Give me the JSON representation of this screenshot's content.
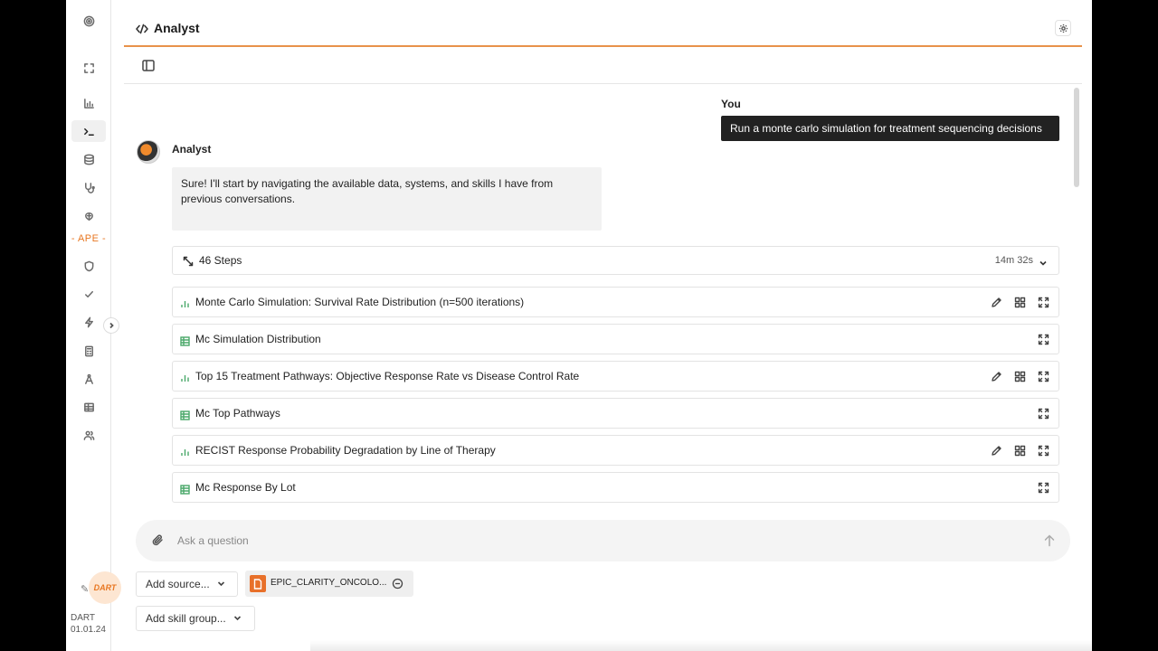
{
  "header": {
    "title": "Analyst"
  },
  "sidebar": {
    "ape_label": "APE",
    "logo_text": "DART",
    "version_name": "DART",
    "version_date": "01.01.24",
    "icons": [
      "target-icon",
      "expand-icon",
      "chart-icon",
      "terminal-icon",
      "database-icon",
      "stethoscope-icon",
      "brain-icon",
      "shield-icon",
      "check-icon",
      "bolt-icon",
      "calculator-icon",
      "compass-icon",
      "table-icon",
      "users-icon"
    ]
  },
  "chat": {
    "user_name": "You",
    "user_message": "Run a monte carlo simulation for treatment sequencing decisions",
    "agent_name": "Analyst",
    "agent_message": "Sure! I'll start by navigating the available data, systems, and skills I have from previous conversations.",
    "steps": {
      "label": "46 Steps",
      "duration": "14m 32s"
    },
    "artifacts": [
      {
        "type": "chart",
        "label": "Monte Carlo Simulation: Survival Rate Distribution (n=500 iterations)"
      },
      {
        "type": "table",
        "label": "Mc Simulation Distribution"
      },
      {
        "type": "chart",
        "label": "Top 15 Treatment Pathways: Objective Response Rate vs Disease Control Rate"
      },
      {
        "type": "table",
        "label": "Mc Top Pathways"
      },
      {
        "type": "chart",
        "label": "RECIST Response Probability Degradation by Line of Therapy"
      },
      {
        "type": "table",
        "label": "Mc Response By Lot"
      }
    ]
  },
  "composer": {
    "placeholder": "Ask a question",
    "add_source_label": "Add source...",
    "source_name": "EPIC_CLARITY_ONCOLO...",
    "add_skill_label": "Add skill group..."
  },
  "colors": {
    "accent": "#e87722",
    "table_icon": "#4aa86a",
    "user_bubble": "#222222"
  }
}
